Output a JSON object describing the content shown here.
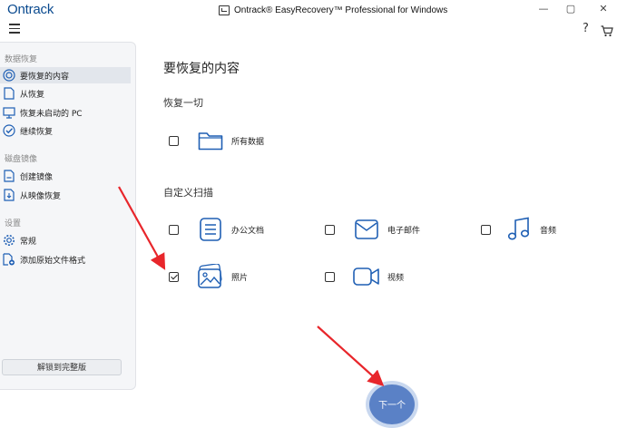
{
  "app": {
    "logo": "Ontrack",
    "title": "Ontrack® EasyRecovery™ Professional for Windows"
  },
  "window_controls": {
    "minimize": "—",
    "maximize": "▢",
    "close": "✕"
  },
  "toolbar": {
    "help": "?"
  },
  "sidebar": {
    "sections": [
      {
        "title": "数据恢复",
        "items": [
          {
            "label": "要恢复的内容",
            "icon": "target-icon",
            "active": true
          },
          {
            "label": "从恢复",
            "icon": "document-icon",
            "active": false
          },
          {
            "label": "恢复未启动的 PC",
            "icon": "monitor-icon",
            "active": false
          },
          {
            "label": "继续恢复",
            "icon": "check-circle-icon",
            "active": false
          }
        ]
      },
      {
        "title": "磁盘镜像",
        "items": [
          {
            "label": "创建镜像",
            "icon": "create-image-icon",
            "active": false
          },
          {
            "label": "从映像恢复",
            "icon": "restore-image-icon",
            "active": false
          }
        ]
      },
      {
        "title": "设置",
        "items": [
          {
            "label": "常规",
            "icon": "gear-icon",
            "active": false
          },
          {
            "label": "添加原始文件格式",
            "icon": "add-file-icon",
            "active": false
          }
        ]
      }
    ],
    "upgrade_label": "解锁到完整版"
  },
  "main": {
    "title": "要恢复的内容",
    "recover_all": {
      "title": "恢复一切",
      "options": [
        {
          "label": "所有数据",
          "checked": false,
          "icon": "folder-icon"
        }
      ]
    },
    "custom_scan": {
      "title": "自定义扫描",
      "options": [
        {
          "label": "办公文档",
          "checked": false,
          "icon": "document-icon"
        },
        {
          "label": "电子邮件",
          "checked": false,
          "icon": "mail-icon"
        },
        {
          "label": "音频",
          "checked": false,
          "icon": "music-icon"
        },
        {
          "label": "照片",
          "checked": true,
          "icon": "photo-icon"
        },
        {
          "label": "视频",
          "checked": false,
          "icon": "video-icon"
        }
      ]
    },
    "next_label": "下一个"
  },
  "colors": {
    "accent": "#1f5fb4",
    "annotation_arrow": "#e8262b",
    "next_button": "#5a81c6"
  }
}
